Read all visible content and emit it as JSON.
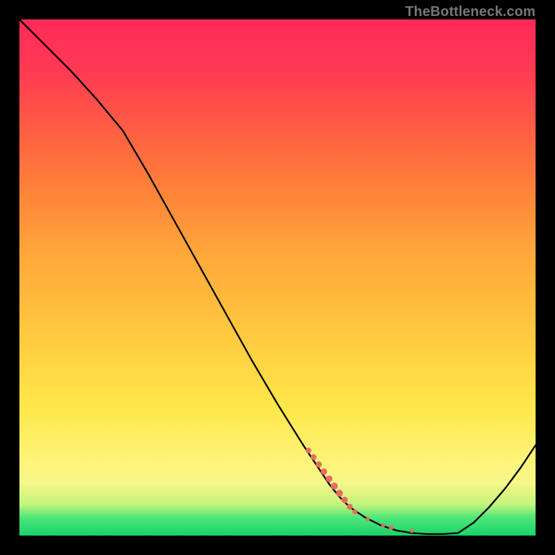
{
  "watermark": {
    "text": "TheBottleneck.com"
  },
  "colors": {
    "gradient_top": "#ff2a58",
    "gradient_mid": "#ffe74a",
    "gradient_bottom": "#18d36a",
    "curve": "#000000",
    "marker_fill": "#e86a61",
    "marker_stroke": "#c94f49",
    "frame": "#000000"
  },
  "chart_data": {
    "type": "line",
    "title": "",
    "xlabel": "",
    "ylabel": "",
    "xlim": [
      0,
      100
    ],
    "ylim": [
      0,
      100
    ],
    "grid": false,
    "legend": false,
    "series": [
      {
        "name": "bottleneck-curve",
        "x": [
          0,
          5,
          10,
          15,
          20,
          25,
          30,
          35,
          40,
          45,
          50,
          55,
          60,
          62,
          64,
          67,
          70,
          73,
          76,
          79,
          82,
          85,
          88,
          91,
          94,
          97,
          100
        ],
        "y": [
          100,
          95,
          90,
          84.5,
          78.5,
          70,
          61,
          52,
          43,
          34,
          25.5,
          17.5,
          10,
          7.5,
          5.5,
          3.5,
          2,
          1,
          0.5,
          0.3,
          0.3,
          0.5,
          2.5,
          5.5,
          9,
          13,
          17.5
        ]
      }
    ],
    "markers": {
      "name": "highlighted-segment",
      "points": [
        {
          "x": 56,
          "y": 16.5,
          "r": 4
        },
        {
          "x": 57,
          "y": 15.2,
          "r": 4.2
        },
        {
          "x": 58,
          "y": 13.8,
          "r": 4.4
        },
        {
          "x": 59,
          "y": 12.4,
          "r": 4.6
        },
        {
          "x": 60,
          "y": 11.0,
          "r": 4.8
        },
        {
          "x": 61,
          "y": 9.6,
          "r": 5
        },
        {
          "x": 62,
          "y": 8.2,
          "r": 5
        },
        {
          "x": 63,
          "y": 6.9,
          "r": 4.6
        },
        {
          "x": 64,
          "y": 5.6,
          "r": 4.2
        },
        {
          "x": 65,
          "y": 4.6,
          "r": 3.6
        },
        {
          "x": 67.5,
          "y": 3.2,
          "r": 3.0
        },
        {
          "x": 70.5,
          "y": 2.0,
          "r": 3.0
        },
        {
          "x": 72,
          "y": 1.5,
          "r": 3.2
        },
        {
          "x": 76,
          "y": 0.9,
          "r": 3.0
        }
      ]
    }
  }
}
